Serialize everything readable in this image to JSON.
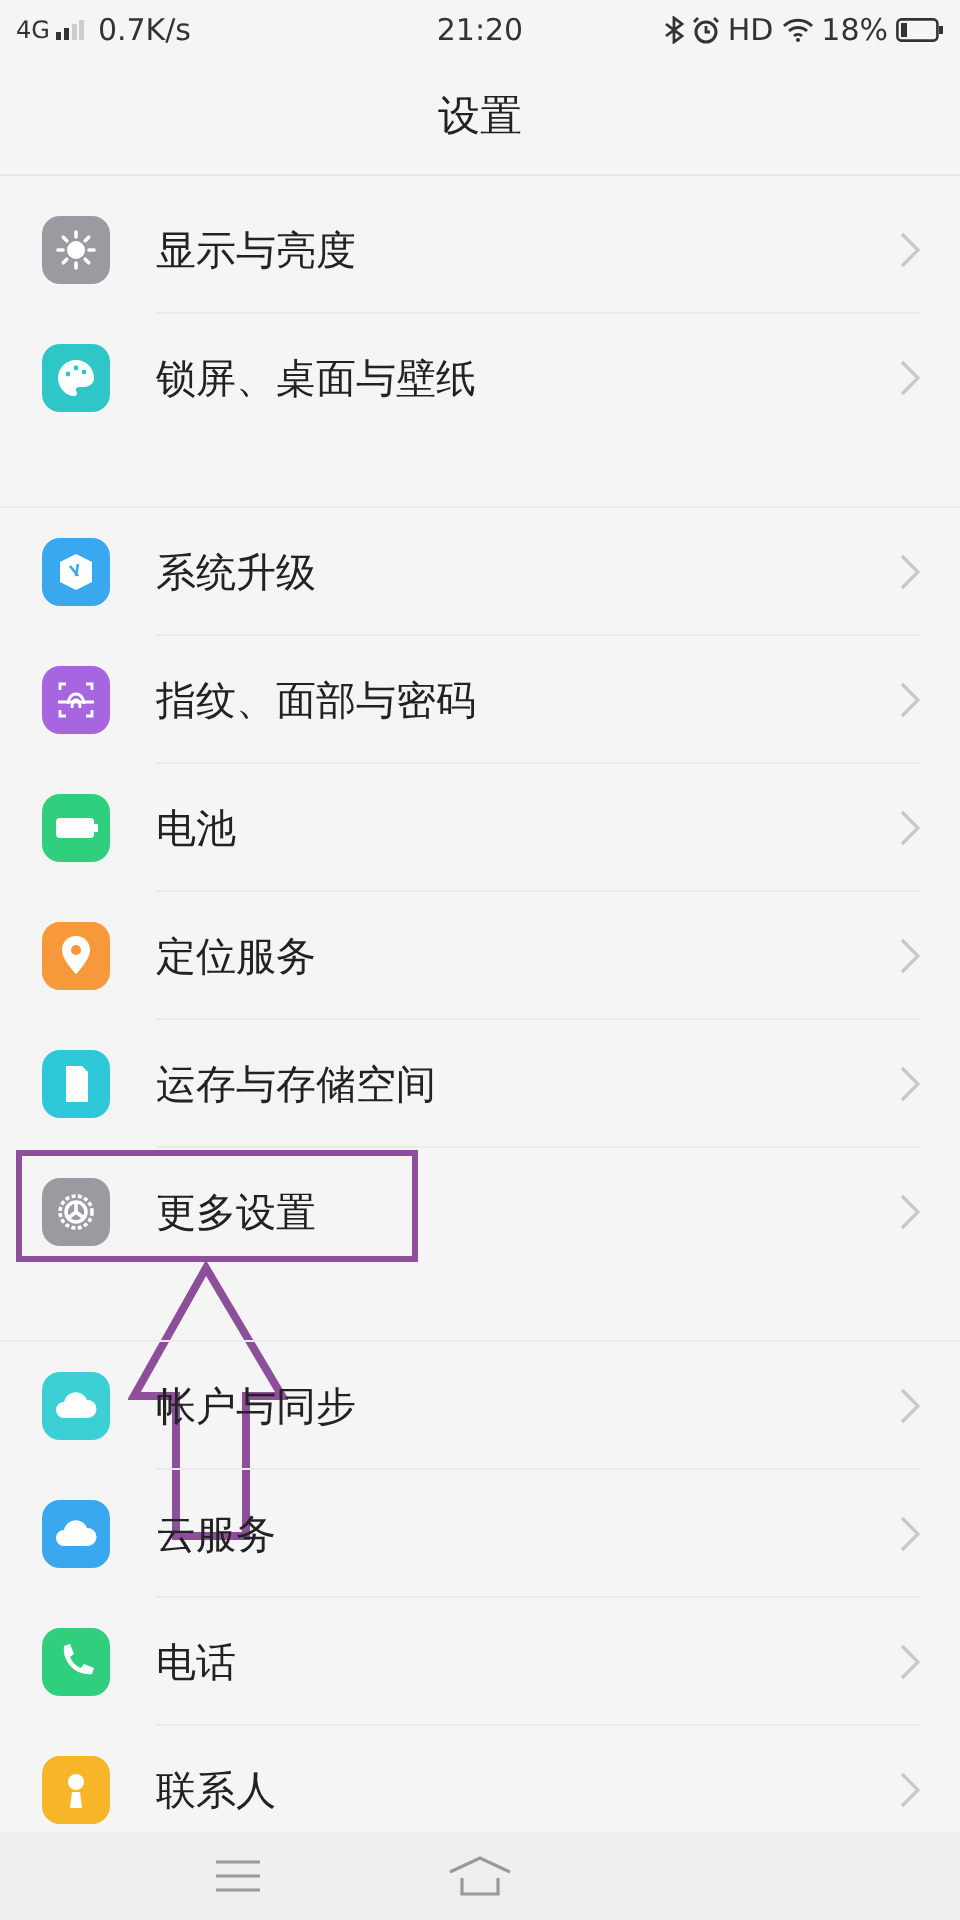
{
  "status_bar": {
    "network": "4G",
    "speed": "0.7K/s",
    "time": "21:20",
    "hd": "HD",
    "battery": "18%"
  },
  "title": "设置",
  "sections": [
    {
      "items": [
        {
          "label": "显示与亮度",
          "kind": "sun",
          "color": "#9a9aa0"
        },
        {
          "label": "锁屏、桌面与壁纸",
          "kind": "palette",
          "color": "#2fc6c8"
        }
      ]
    },
    {
      "items": [
        {
          "label": "系统升级",
          "kind": "box",
          "color": "#3aa8ee"
        },
        {
          "label": "指纹、面部与密码",
          "kind": "fingerprint",
          "color": "#a766e0"
        },
        {
          "label": "电池",
          "kind": "battery",
          "color": "#2fcf7e"
        },
        {
          "label": "定位服务",
          "kind": "pin",
          "color": "#f7993a"
        },
        {
          "label": "运存与存储空间",
          "kind": "card",
          "color": "#2fc8d8"
        },
        {
          "label": "更多设置",
          "kind": "gear",
          "color": "#9a9aa0"
        }
      ]
    },
    {
      "items": [
        {
          "label": "帐户与同步",
          "kind": "cloud",
          "color": "#3ccfd6"
        },
        {
          "label": "云服务",
          "kind": "cloud",
          "color": "#3aa8ee"
        },
        {
          "label": "电话",
          "kind": "phone",
          "color": "#2fcf7e"
        },
        {
          "label": "联系人",
          "kind": "person",
          "color": "#f7b52a"
        }
      ]
    }
  ]
}
